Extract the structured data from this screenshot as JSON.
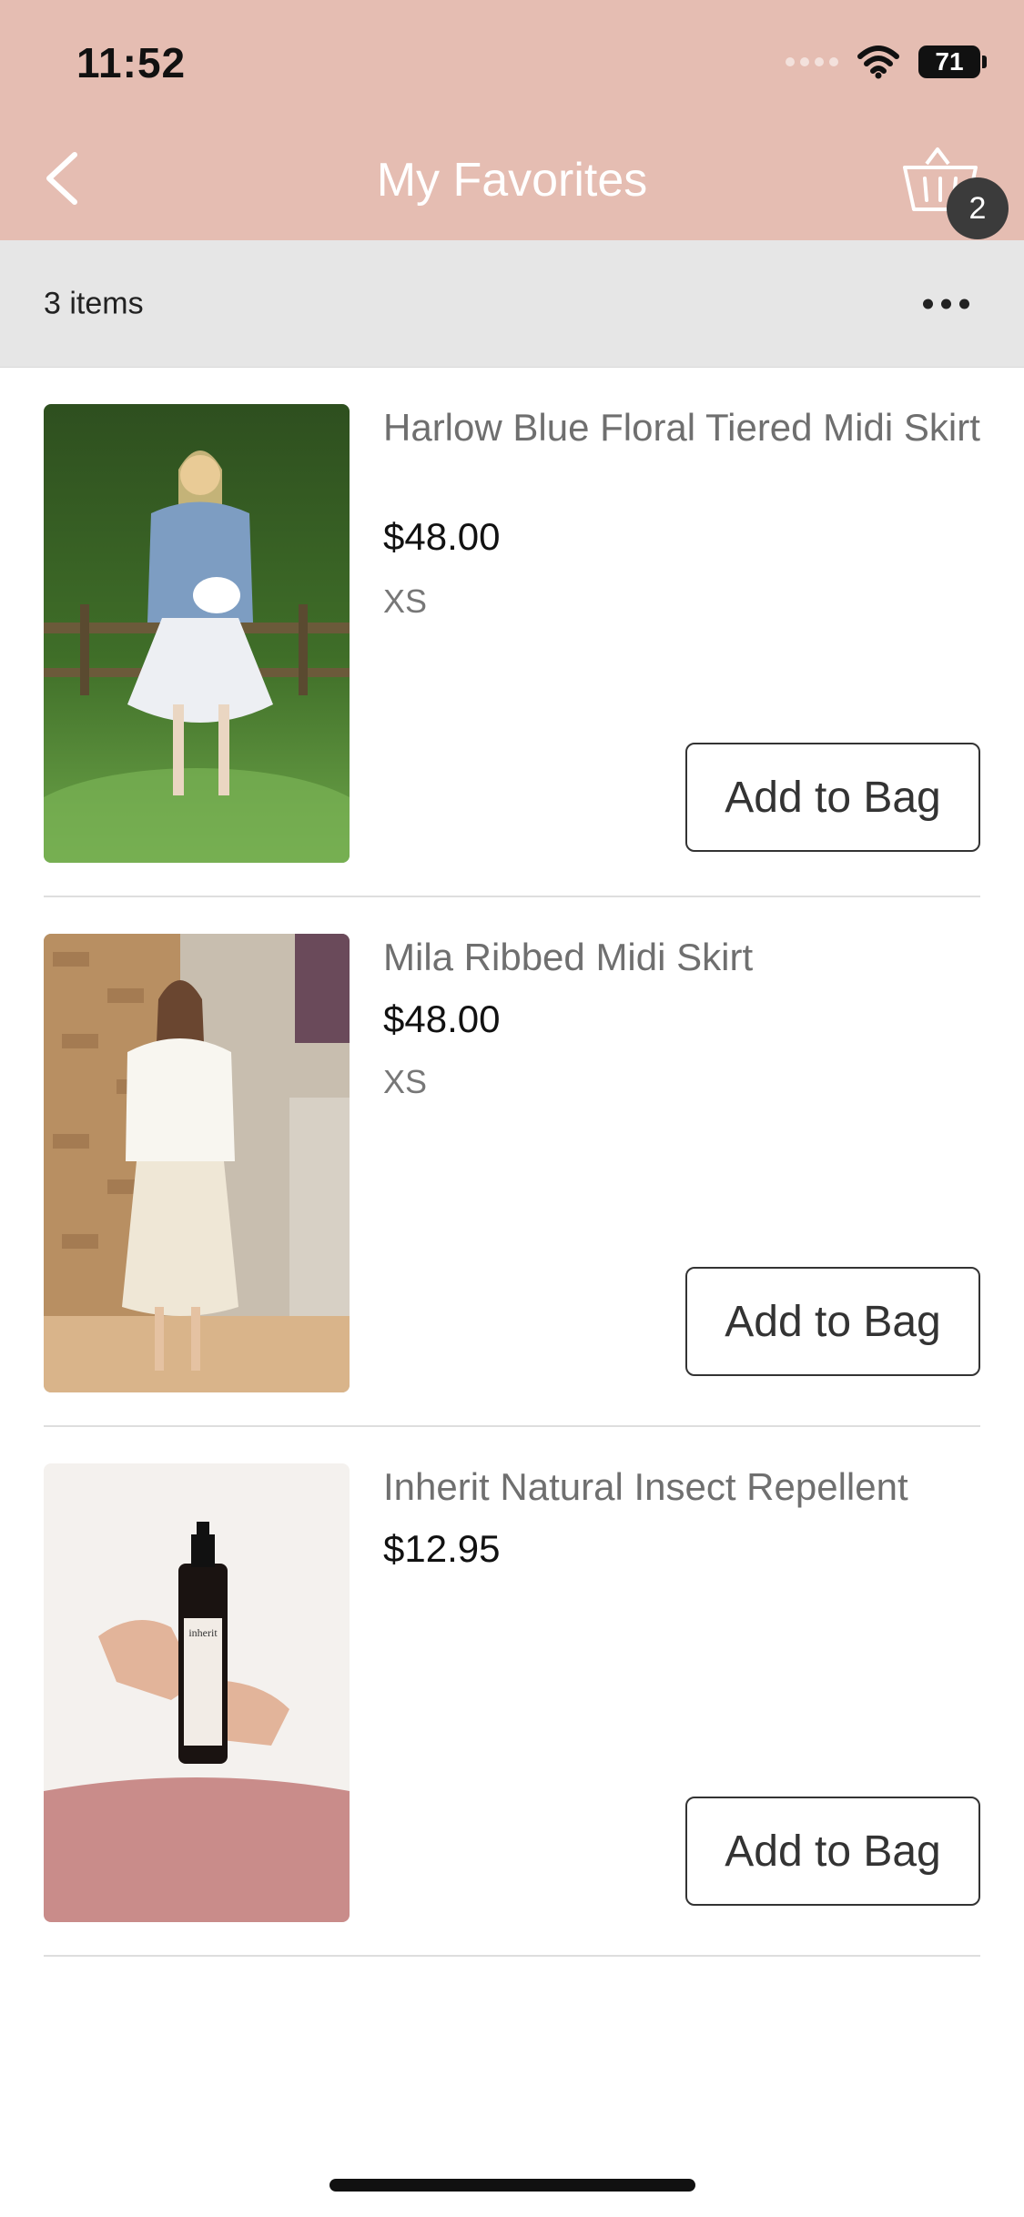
{
  "status_bar": {
    "time": "11:52",
    "battery": "71"
  },
  "header": {
    "title": "My Favorites",
    "bag_count": "2"
  },
  "list_header": {
    "items_count": "3 items"
  },
  "items": [
    {
      "name": "Harlow Blue Floral Tiered Midi Skirt",
      "price": "$48.00",
      "size": "XS",
      "button": "Add to Bag"
    },
    {
      "name": "Mila Ribbed Midi Skirt",
      "price": "$48.00",
      "size": "XS",
      "button": "Add to Bag"
    },
    {
      "name": "Inherit Natural Insect Repellent",
      "price": "$12.95",
      "size": "",
      "button": "Add to Bag"
    }
  ],
  "colors": {
    "header_bg": "#E5BDB2",
    "items_bar_bg": "#E6E6E6",
    "badge_bg": "#3B3B3B"
  }
}
